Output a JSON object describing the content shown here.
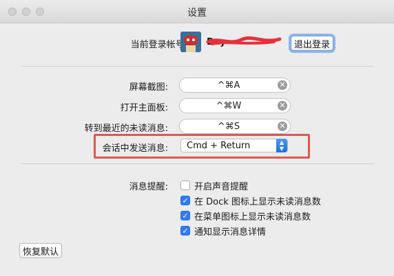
{
  "window": {
    "title": "设置"
  },
  "account": {
    "label": "当前登录帐号:",
    "username": "Day",
    "logout_label": "退出登录"
  },
  "shortcuts": [
    {
      "label": "屏幕截图:",
      "value": "^⌘A"
    },
    {
      "label": "打开主面板:",
      "value": "^⌘W"
    },
    {
      "label": "转到最近的未读消息:",
      "value": "^⌘S"
    }
  ],
  "send_message": {
    "label": "会话中发送消息:",
    "selected": "Cmd + Return"
  },
  "notifications": {
    "label": "消息提醒:",
    "options": [
      {
        "label": "开启声音提醒",
        "checked": false
      },
      {
        "label": "在 Dock 图标上显示未读消息数",
        "checked": true
      },
      {
        "label": "在菜单图标上显示未读消息数",
        "checked": true
      },
      {
        "label": "通知显示消息详情",
        "checked": true
      }
    ]
  },
  "restore_defaults_label": "恢复默认",
  "icons": {
    "clear": "clear-icon",
    "dropdown": "updown-chevron-icon",
    "checkmark": "checkmark-icon"
  },
  "colors": {
    "highlight": "#e2564f",
    "checkbox_checked": "#2f7cf6",
    "focus_ring": "#8fb5ea"
  }
}
